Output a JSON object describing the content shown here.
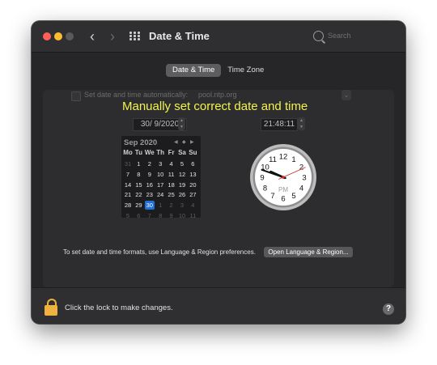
{
  "window": {
    "title": "Date & Time"
  },
  "search": {
    "placeholder": "Search"
  },
  "tabs": [
    "Date & Time",
    "Time Zone"
  ],
  "auto": {
    "label": "Set date and time automatically:",
    "server": "pool.ntp.org"
  },
  "overlay": "Manually set correct date and time",
  "date_field": "30/ 9/2020",
  "time_field": "21:48:11",
  "calendar": {
    "month": "Sep 2020",
    "weekdays": [
      "Mo",
      "Tu",
      "We",
      "Th",
      "Fr",
      "Sa",
      "Su"
    ],
    "days": [
      [
        "31",
        "1",
        "2",
        "3",
        "4",
        "5",
        "6"
      ],
      [
        "7",
        "8",
        "9",
        "10",
        "11",
        "12",
        "13"
      ],
      [
        "14",
        "15",
        "16",
        "17",
        "18",
        "19",
        "20"
      ],
      [
        "21",
        "22",
        "23",
        "24",
        "25",
        "26",
        "27"
      ],
      [
        "28",
        "29",
        "30",
        "1",
        "2",
        "3",
        "4"
      ],
      [
        "5",
        "6",
        "7",
        "8",
        "9",
        "10",
        "11"
      ]
    ],
    "selected": "30"
  },
  "clock": {
    "numbers": [
      "12",
      "1",
      "2",
      "3",
      "4",
      "5",
      "6",
      "7",
      "8",
      "9",
      "10",
      "11"
    ],
    "period": "PM",
    "hour": 21,
    "minute": 48,
    "second": 11
  },
  "hint": "To set date and time formats, use Language & Region preferences.",
  "lang_button": "Open Language & Region...",
  "lock_text": "Click the lock to make changes.",
  "help": "?",
  "colors": {
    "accent": "#1f6fd8",
    "overlay": "#f3f34d",
    "lock": "#f0b23f"
  }
}
